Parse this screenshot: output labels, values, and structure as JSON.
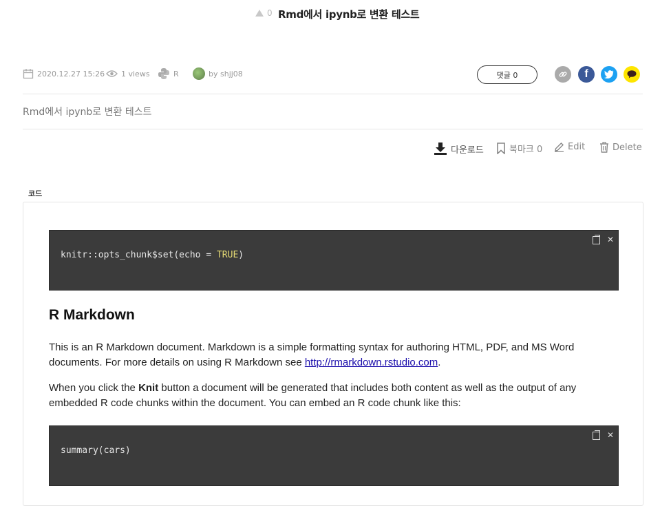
{
  "header": {
    "vote_count": "0",
    "title": "Rmd에서 ipynb로 변환 테스트"
  },
  "meta": {
    "date": "2020.12.27 15:26",
    "views": "1 views",
    "language": "R",
    "author": "by shjj08",
    "comment_button": "댓글 0"
  },
  "share": {
    "link_icon": "link-icon",
    "facebook": "f",
    "twitter": "twitter-icon",
    "kakao": "kakao-icon",
    "colors": {
      "link": "#aaaaaa",
      "facebook": "#3b5998",
      "twitter": "#1da1f2",
      "kakao": "#fee500"
    }
  },
  "subtitle": "Rmd에서 ipynb로 변환 테스트",
  "actions": {
    "download": "다운로드",
    "bookmark": "북마크 0",
    "edit": "Edit",
    "delete": "Delete"
  },
  "code_label": "코드",
  "content": {
    "code1_prefix": "knitr::opts_chunk$set(echo = ",
    "code1_keyword": "TRUE",
    "code1_suffix": ")",
    "heading": "R Markdown",
    "para1_text": "This is an R Markdown document. Markdown is a simple formatting syntax for authoring HTML, PDF, and MS Word documents. For more details on using R Markdown see ",
    "para1_link": "http://rmarkdown.rstudio.com",
    "para1_end": ".",
    "para2_start": "When you click the ",
    "para2_bold": "Knit",
    "para2_end": " button a document will be generated that includes both content as well as the output of any embedded R code chunks within the document. You can embed an R code chunk like this:",
    "code2": "summary(cars)"
  }
}
